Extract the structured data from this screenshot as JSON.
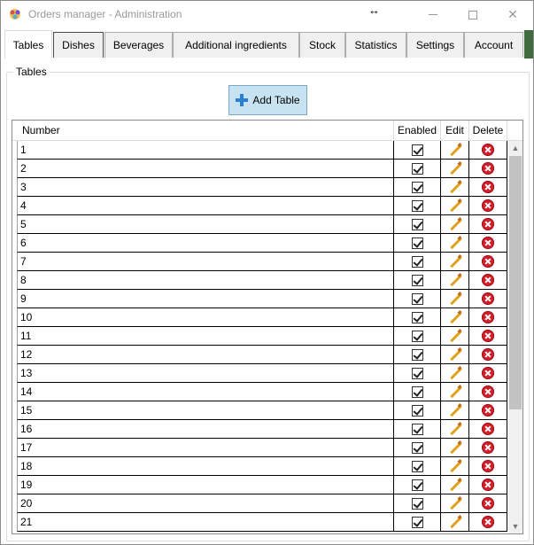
{
  "window": {
    "title": "Orders manager - Administration",
    "minimize_label": "minimize",
    "maximize_label": "maximize",
    "close_symbol": "✕",
    "cursor_symbol": "↔"
  },
  "tabs": [
    {
      "label": "Tables",
      "active": true
    },
    {
      "label": "Dishes",
      "active": false
    },
    {
      "label": "Beverages",
      "active": false
    },
    {
      "label": "Additional ingredients",
      "active": false
    },
    {
      "label": "Stock",
      "active": false
    },
    {
      "label": "Statistics",
      "active": false
    },
    {
      "label": "Settings",
      "active": false
    },
    {
      "label": "Account",
      "active": false
    }
  ],
  "group": {
    "title": "Tables",
    "add_button_label": "Add Table"
  },
  "grid": {
    "columns": {
      "number": "Number",
      "enabled": "Enabled",
      "edit": "Edit",
      "delete": "Delete"
    },
    "rows": [
      {
        "number": "1",
        "enabled": true
      },
      {
        "number": "2",
        "enabled": true
      },
      {
        "number": "3",
        "enabled": true
      },
      {
        "number": "4",
        "enabled": true
      },
      {
        "number": "5",
        "enabled": true
      },
      {
        "number": "6",
        "enabled": true
      },
      {
        "number": "7",
        "enabled": true
      },
      {
        "number": "8",
        "enabled": true
      },
      {
        "number": "9",
        "enabled": true
      },
      {
        "number": "10",
        "enabled": true
      },
      {
        "number": "11",
        "enabled": true
      },
      {
        "number": "12",
        "enabled": true
      },
      {
        "number": "13",
        "enabled": true
      },
      {
        "number": "14",
        "enabled": true
      },
      {
        "number": "15",
        "enabled": true
      },
      {
        "number": "16",
        "enabled": true
      },
      {
        "number": "17",
        "enabled": true
      },
      {
        "number": "18",
        "enabled": true
      },
      {
        "number": "19",
        "enabled": true
      },
      {
        "number": "20",
        "enabled": true
      },
      {
        "number": "21",
        "enabled": true
      }
    ]
  },
  "colors": {
    "accent_button": "#c7e3f2",
    "delete_red": "#d41f2b",
    "edit_pencil": "#e0a21c",
    "add_plus": "#2d7fd2"
  },
  "icons": {
    "app": "app-icon",
    "add": "plus-icon",
    "edit": "pencil-icon",
    "delete": "delete-icon",
    "enabled": "checkbox-checked"
  }
}
